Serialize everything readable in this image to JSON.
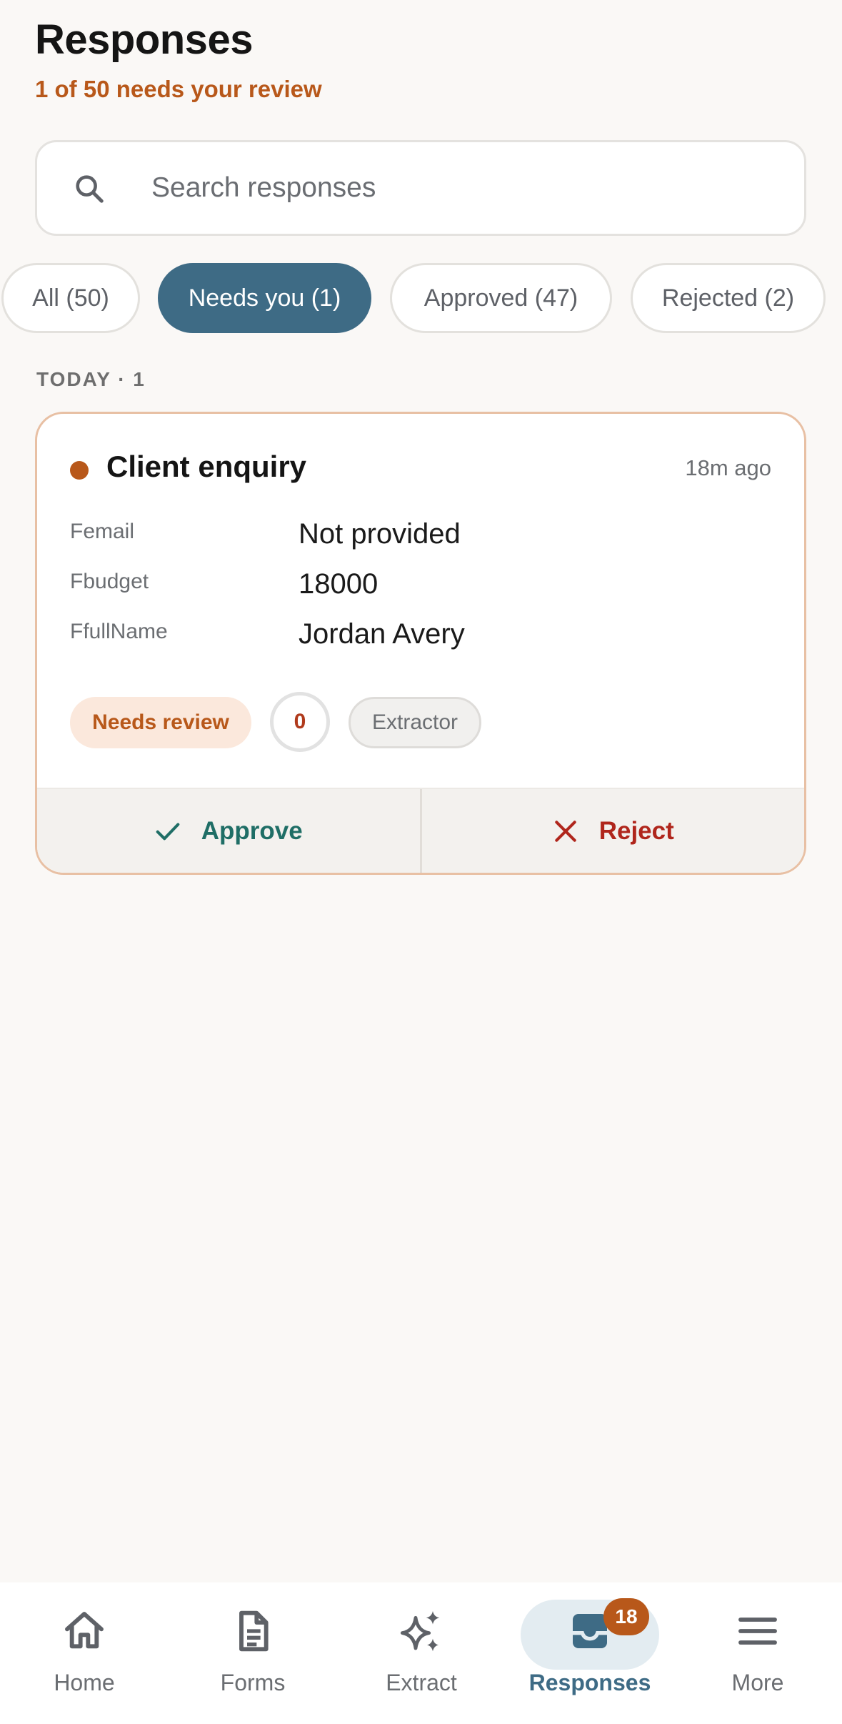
{
  "header": {
    "title": "Responses",
    "subtitle": "1 of 50 needs your review"
  },
  "search": {
    "placeholder": "Search responses",
    "icon": "search-icon"
  },
  "filters": [
    {
      "label": "All (50)",
      "active": false
    },
    {
      "label": "Needs you (1)",
      "active": true
    },
    {
      "label": "Approved (47)",
      "active": false
    },
    {
      "label": "Rejected (2)",
      "active": false
    }
  ],
  "section": {
    "label": "TODAY · 1"
  },
  "response_card": {
    "title": "Client enquiry",
    "time": "18m ago",
    "status_dot_color": "#b8581a",
    "fields": [
      {
        "label": "Femail",
        "value": "Not provided"
      },
      {
        "label": "Fbudget",
        "value": "18000"
      },
      {
        "label": "FfullName",
        "value": "Jordan Avery"
      }
    ],
    "status_badge": "Needs review",
    "count": "0",
    "source": "Extractor",
    "approve_label": "Approve",
    "reject_label": "Reject"
  },
  "tabbar": {
    "items": [
      {
        "label": "Home",
        "icon": "home-icon"
      },
      {
        "label": "Forms",
        "icon": "document-icon"
      },
      {
        "label": "Extract",
        "icon": "sparkle-icon"
      },
      {
        "label": "Responses",
        "icon": "inbox-icon",
        "active": true,
        "badge": "18"
      },
      {
        "label": "More",
        "icon": "menu-icon"
      }
    ]
  },
  "colors": {
    "accent": "#3e6b85",
    "warning": "#b8581a",
    "approve": "#1f6e66",
    "reject": "#b0261c",
    "background": "#faf8f6"
  }
}
